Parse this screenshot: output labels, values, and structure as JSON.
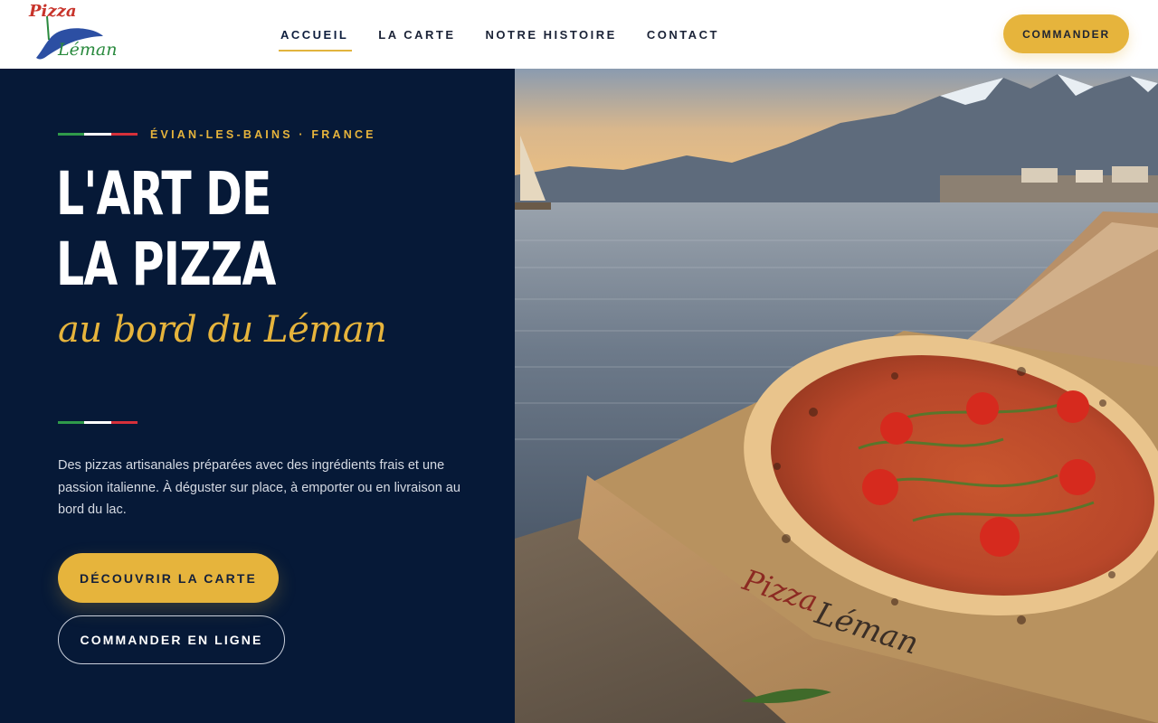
{
  "header": {
    "logo": {
      "word1": "Pizza",
      "word2": "Léman"
    },
    "nav": [
      {
        "label": "ACCUEIL",
        "active": true
      },
      {
        "label": "LA CARTE",
        "active": false
      },
      {
        "label": "NOTRE HISTOIRE",
        "active": false
      },
      {
        "label": "CONTACT",
        "active": false
      }
    ],
    "order_button": "COMMANDER"
  },
  "hero": {
    "eyebrow": "ÉVIAN-LES-BAINS · FRANCE",
    "title_line1": "L'ART DE",
    "title_line2": "LA PIZZA",
    "subtitle": "au bord du Léman",
    "description": "Des pizzas artisanales préparées avec des ingrédients frais et une passion italienne. À déguster sur place, à emporter ou en livraison au bord du lac.",
    "primary_button": "DÉCOUVRIR LA CARTE",
    "secondary_button": "COMMANDER EN LIGNE",
    "image": {
      "box_print_1": "Pizza",
      "box_print_2": "Léman"
    }
  },
  "colors": {
    "navy": "#061937",
    "gold": "#e6b43c",
    "italy_green": "#2f9a4a",
    "italy_white": "#ffffff",
    "italy_red": "#d6303a"
  }
}
